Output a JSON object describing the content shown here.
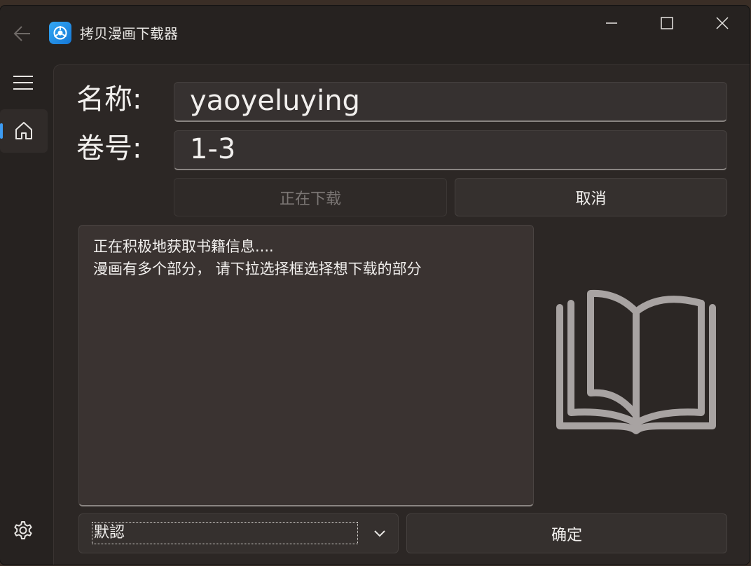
{
  "window": {
    "title": "拷贝漫画下载器",
    "accent": "#3d9cf3"
  },
  "icons": {
    "back": "back-arrow-icon",
    "app": "app-logo-icon",
    "minimize": "minimize-icon",
    "maximize": "maximize-icon",
    "close": "close-icon",
    "menu": "hamburger-menu-icon",
    "home": "home-icon",
    "settings": "gear-icon",
    "book": "book-icon",
    "dropdown": "chevron-down-icon"
  },
  "form": {
    "name_label": "名称:",
    "name_value": "yaoyeluying",
    "volume_label": "卷号:",
    "volume_value": "1-3"
  },
  "actions": {
    "download_label": "正在下载",
    "cancel_label": "取消",
    "confirm_label": "确定"
  },
  "log": {
    "lines": [
      "正在积极地获取书籍信息....",
      "漫画有多个部分， 请下拉选择框选择想下载的部分"
    ]
  },
  "part_select": {
    "selected": "默認"
  }
}
